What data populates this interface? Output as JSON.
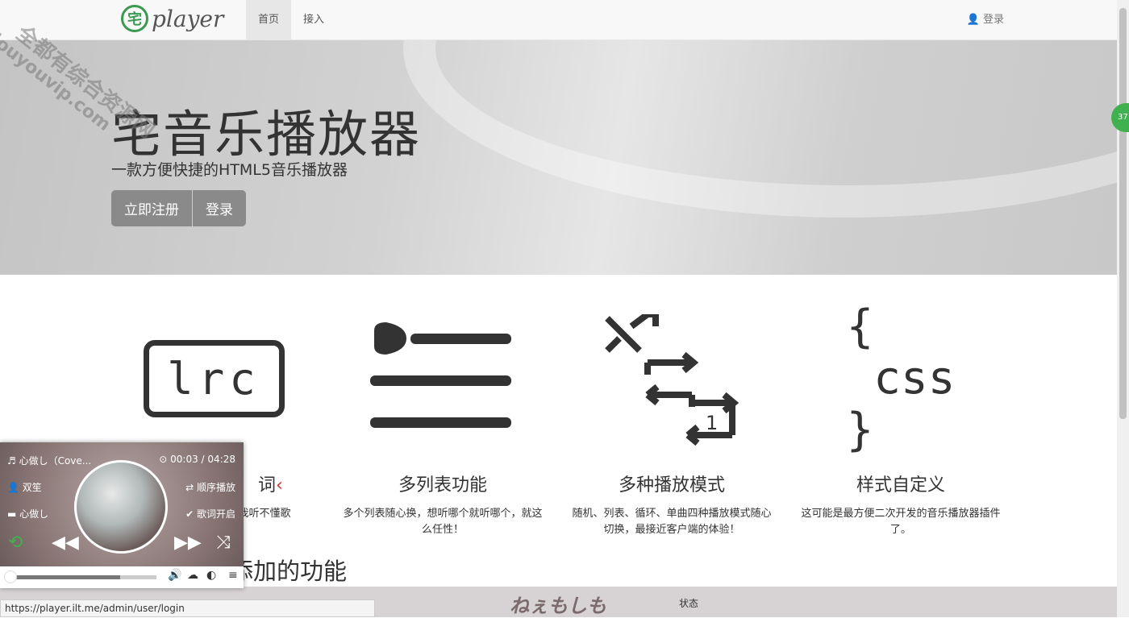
{
  "nav": {
    "logo_mark": "宅",
    "logo_text": "player",
    "items": [
      {
        "label": "首页",
        "active": true
      },
      {
        "label": "接入",
        "active": false
      }
    ],
    "login": "登录"
  },
  "watermark": {
    "line1": "全都有综合资源网",
    "line2": "douyouvip.com"
  },
  "side_badge": "37",
  "hero": {
    "title": "宅音乐播放器",
    "subtitle": "一款方便快捷的HTML5音乐播放器",
    "register": "立即注册",
    "login": "登录"
  },
  "features": [
    {
      "icon": "lrc",
      "title": "词",
      "desc": "不怕我听不懂歌"
    },
    {
      "icon": "list",
      "title": "多列表功能",
      "desc": "多个列表随心换，想听哪个就听哪个，就这么任性！"
    },
    {
      "icon": "modes",
      "title": "多种播放模式",
      "desc": "随机、列表、循环、单曲四种播放模式随心切换，最接近客户端的体验！"
    },
    {
      "icon": "css",
      "title": "样式自定义",
      "desc": "这可能是最方便二次开发的音乐播放器插件了。"
    }
  ],
  "lrc_icon_text": "lrc",
  "css_icon_text": "css",
  "future_title": "未来可能会添加的功能",
  "bottom": {
    "name": "ねぇもしも",
    "status": "状态"
  },
  "player": {
    "song": "心做し（Cove...",
    "time": "00:03 / 04:28",
    "artist": "双笙",
    "album": "心做し",
    "mode": "顺序播放",
    "lyrics": "歌词开启",
    "progress_fraction": 0.75,
    "accent": "#3fb24f"
  },
  "status_url": "https://player.ilt.me/admin/user/login"
}
